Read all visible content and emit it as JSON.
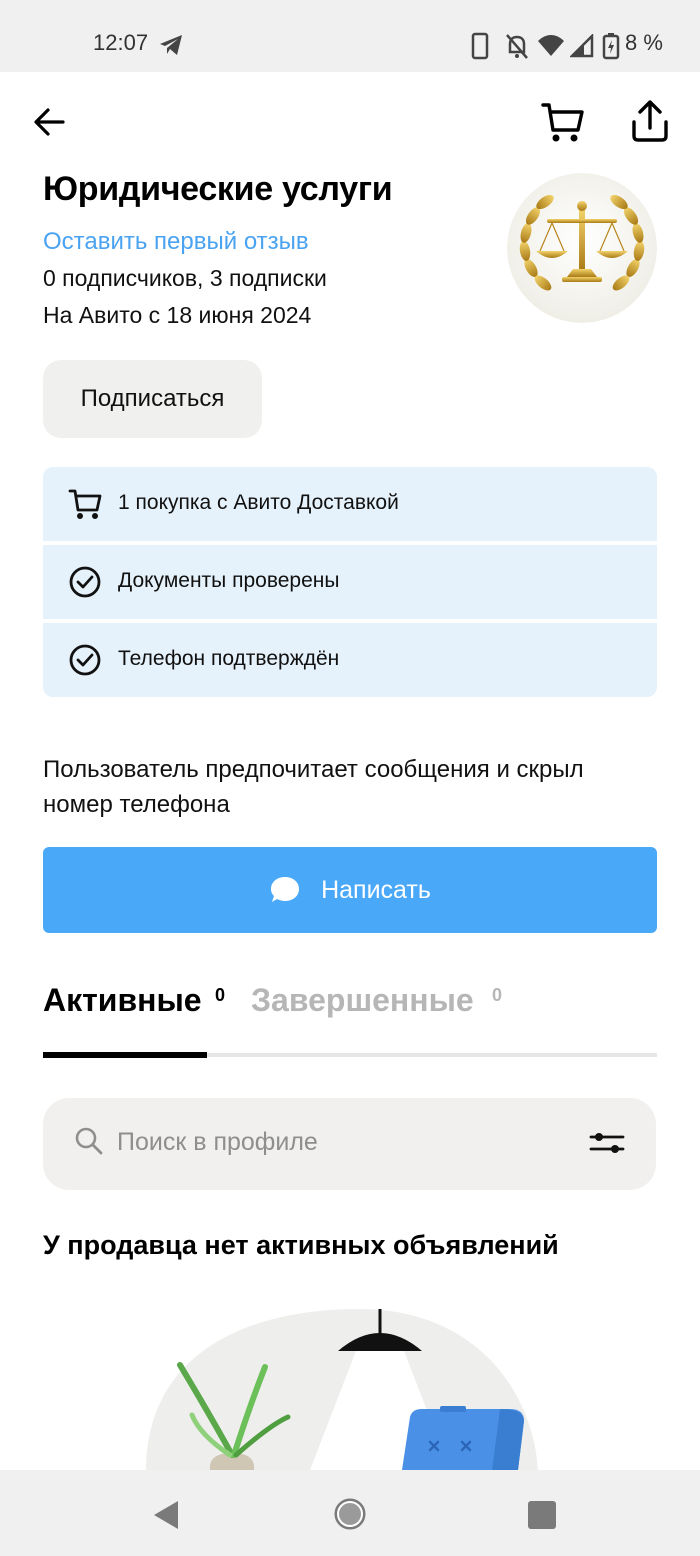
{
  "status_bar": {
    "time": "12:07",
    "battery": "8 %"
  },
  "profile": {
    "name": "Юридические услуги",
    "review_link": "Оставить первый отзыв",
    "followers": "0 подписчиков, 3 подписки",
    "since": "На Авито с 18 июня 2024",
    "subscribe_label": "Подписаться"
  },
  "badges": [
    {
      "icon": "cart-icon",
      "label": "1 покупка с Авито Доставкой"
    },
    {
      "icon": "check-circle-icon",
      "label": "Документы проверены"
    },
    {
      "icon": "check-circle-icon",
      "label": "Телефон подтверждён"
    }
  ],
  "contact": {
    "preference_text": "Пользователь предпочитает сообщения и скрыл номер телефона",
    "write_label": "Написать"
  },
  "tabs": [
    {
      "label": "Активные",
      "count": "0",
      "active": true
    },
    {
      "label": "Завершенные",
      "count": "0",
      "active": false
    }
  ],
  "search": {
    "placeholder": "Поиск в профиле",
    "value": ""
  },
  "empty_state": {
    "title": "У продавца нет активных объявлений"
  },
  "colors": {
    "accent": "#4aa8f8",
    "link": "#4aa3f0",
    "badge_bg": "#e6f2fb",
    "chip_bg": "#f0f0ee"
  }
}
